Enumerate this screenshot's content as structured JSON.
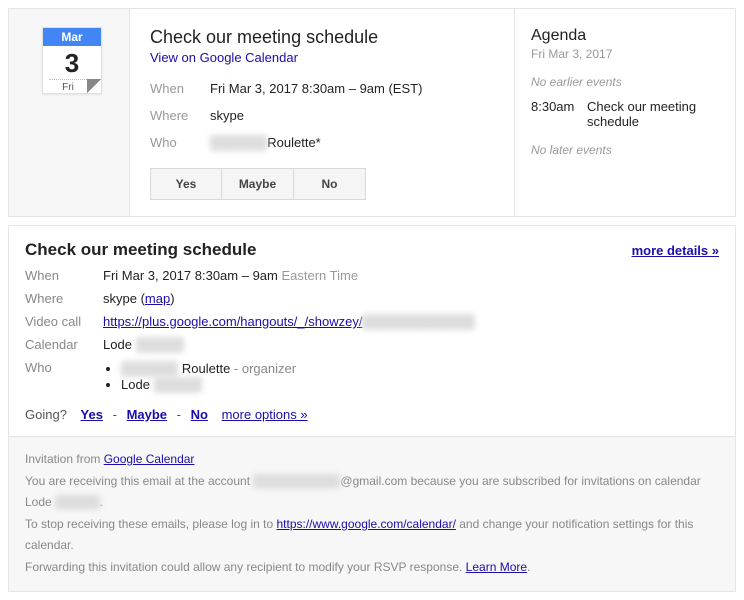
{
  "date_tile": {
    "month": "Mar",
    "day": "3",
    "weekday": "Fri"
  },
  "event": {
    "title": "Check our meeting schedule",
    "view_link": "View on Google Calendar",
    "when_label": "When",
    "when_value": "Fri Mar 3, 2017 8:30am – 9am (EST)",
    "where_label": "Where",
    "where_value": "skype",
    "who_label": "Who",
    "who_redacted": "██████",
    "who_name": "Roulette*"
  },
  "rsvp": {
    "yes": "Yes",
    "maybe": "Maybe",
    "no": "No"
  },
  "agenda": {
    "heading": "Agenda",
    "date": "Fri Mar 3, 2017",
    "no_earlier": "No earlier events",
    "event_time": "8:30am",
    "event_title": "Check our meeting schedule",
    "no_later": "No later events"
  },
  "detail": {
    "title": "Check our meeting schedule",
    "more": "more details »",
    "when_label": "When",
    "when_value": "Fri Mar 3, 2017 8:30am – 9am ",
    "when_tz": "Eastern Time",
    "where_label": "Where",
    "where_value": "skype",
    "map_open": " (",
    "map": "map",
    "map_close": ")",
    "video_label": "Video call",
    "video_url": "https://plus.google.com/hangouts/_/showzey/",
    "video_url_redacted": "████████████",
    "calendar_label": "Calendar",
    "calendar_name": "Lode ",
    "calendar_redacted": "█████",
    "who_label": "Who",
    "who1_redacted": "██████",
    "who1_name": " Roulette",
    "who1_role": " - organizer",
    "who2_name": "Lode ",
    "who2_redacted": "█████"
  },
  "going": {
    "label": "Going?",
    "yes": "Yes",
    "maybe": "Maybe",
    "no": "No",
    "more": "more options »"
  },
  "footer": {
    "l1a": "Invitation from ",
    "l1b": "Google Calendar",
    "l2a": "You are receiving this email at the account ",
    "l2_redacted1": "██████████",
    "l2b": "@gmail.com because you are subscribed for invitations on calendar Lode ",
    "l2_redacted2": "█████",
    "l2c": ".",
    "l3a": "To stop receiving these emails, please log in to ",
    "l3b": "https://www.google.com/calendar/",
    "l3c": " and change your notification settings for this calendar.",
    "l4a": "Forwarding this invitation could allow any recipient to modify your RSVP response. ",
    "l4b": "Learn More",
    "l4c": "."
  }
}
